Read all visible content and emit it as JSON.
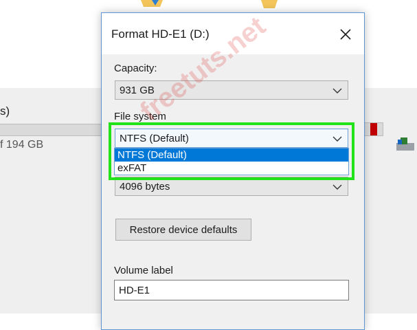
{
  "background": {
    "text1": "s)",
    "text2": "f 194 GB"
  },
  "dialog": {
    "title": "Format HD-E1 (D:)",
    "capacity": {
      "label": "Capacity:",
      "value": "931 GB"
    },
    "file_system": {
      "label": "File system",
      "value": "NTFS (Default)",
      "options": [
        "NTFS (Default)",
        "exFAT"
      ]
    },
    "allocation": {
      "value": "4096 bytes"
    },
    "restore_button": "Restore device defaults",
    "volume_label": {
      "label": "Volume label",
      "value": "HD-E1"
    }
  },
  "watermark": "freetuts.net",
  "colors": {
    "highlight": "#22e21a",
    "selection": "#0078d7",
    "dialog_border": "#5c95d3"
  }
}
